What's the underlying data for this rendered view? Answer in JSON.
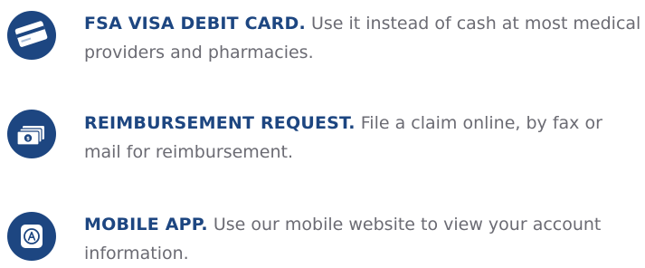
{
  "items": [
    {
      "icon": "credit-card-icon",
      "heading": "FSA VISA DEBIT CARD.",
      "body": " Use it instead of cash at most medical providers and pharmacies."
    },
    {
      "icon": "cash-stack-icon",
      "heading": "REIMBURSEMENT REQUEST.",
      "body": "File a claim online, by fax or mail for reimbursement."
    },
    {
      "icon": "mobile-app-icon",
      "heading": "MOBILE APP.",
      "body": "Use our mobile website to view your account information."
    }
  ],
  "colors": {
    "heading": "#1d4681",
    "icon_background": "#1d4681",
    "body_text": "#6b6b73",
    "background": "#ffffff"
  }
}
